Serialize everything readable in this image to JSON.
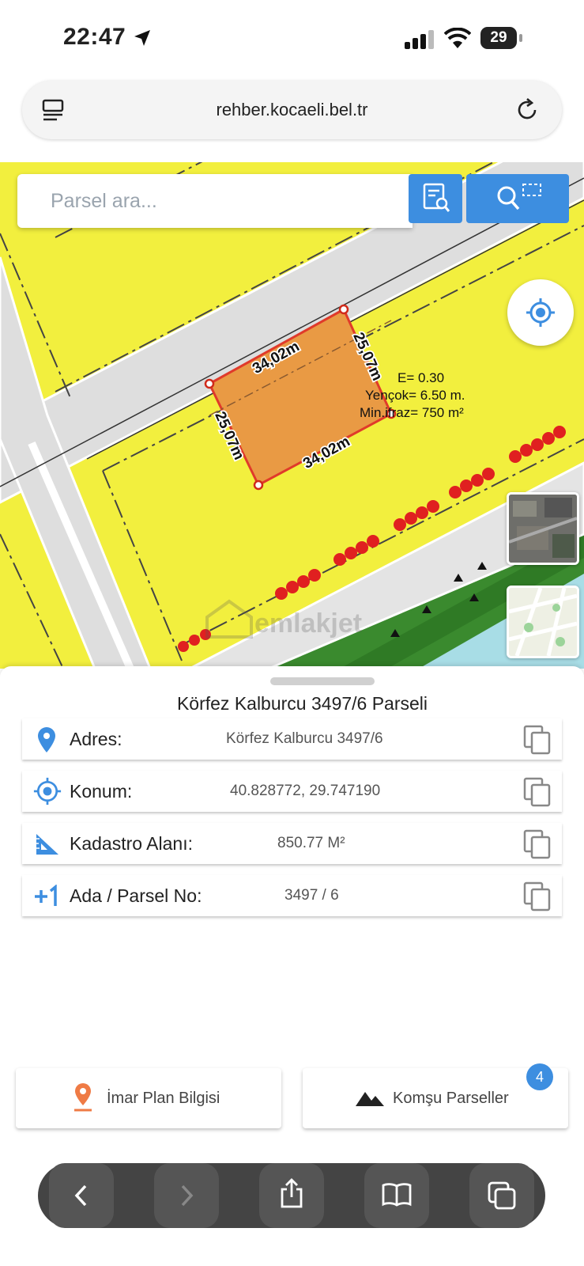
{
  "status": {
    "time": "22:47",
    "battery": "29"
  },
  "browser": {
    "url": "rehber.kocaeli.bel.tr"
  },
  "map": {
    "search_placeholder": "Parsel ara...",
    "edge_top": "34,02m",
    "edge_bottom": "34,02m",
    "edge_left": "25,07m",
    "edge_right": "25,07m",
    "zoning": [
      "E= 0.30",
      "Yençok= 6.50 m.",
      "Min.ifraz= 750 m²"
    ],
    "watermark": "emlakjet",
    "colors": {
      "zone": "#f2ef3e",
      "parcel": "#e99a44",
      "parcel_border": "#e03a2a",
      "road": "#dedede",
      "trees": "#e02020",
      "green": "#3a8a2e",
      "water": "#a8dde6",
      "accent": "#3d8ee0"
    }
  },
  "sheet": {
    "title": "Körfez Kalburcu 3497/6 Parseli",
    "rows": [
      {
        "label": "Adres:",
        "value": "Körfez Kalburcu 3497/6",
        "icon": "location-pin-icon"
      },
      {
        "label": "Konum:",
        "value": "40.828772, 29.747190",
        "icon": "crosshair-icon"
      },
      {
        "label": "Kadastro Alanı:",
        "value": "850.77 M²",
        "icon": "ruler-triangle-icon"
      },
      {
        "label": "Ada / Parsel No:",
        "value": "3497 / 6",
        "icon": "plus-one-icon"
      }
    ],
    "buttons": {
      "imar": "İmar Plan Bilgisi",
      "komsu": "Komşu Parseller",
      "komsu_count": "4"
    }
  }
}
